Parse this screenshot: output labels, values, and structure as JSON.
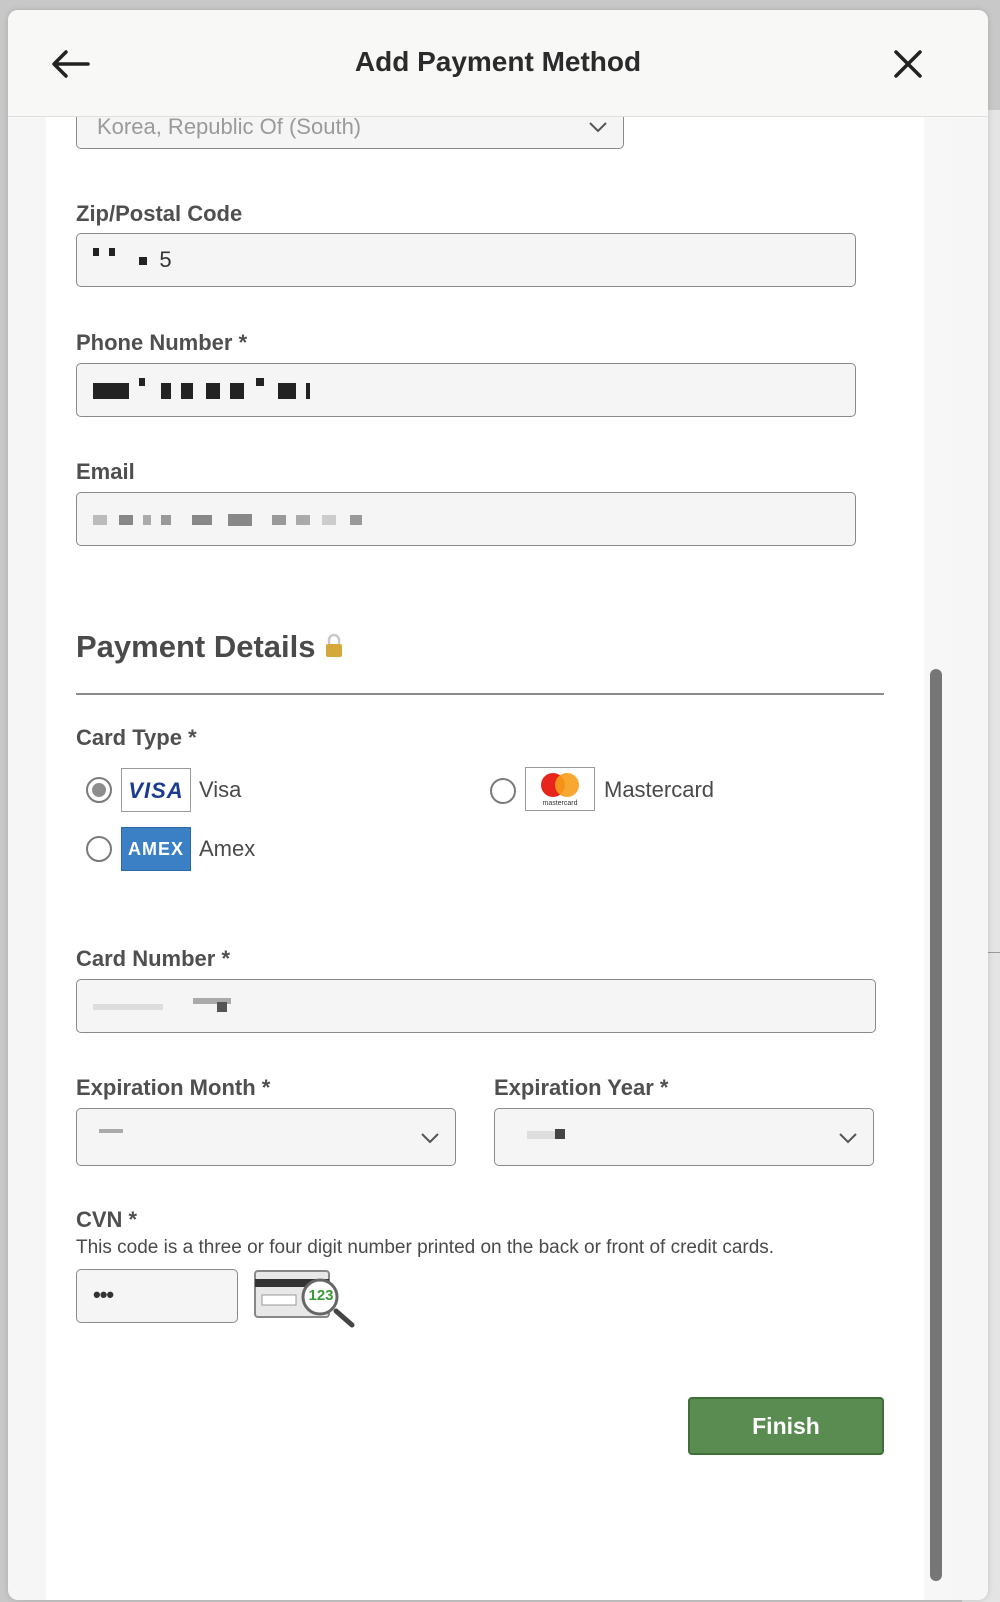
{
  "header": {
    "title": "Add Payment Method"
  },
  "address": {
    "country_value": "Korea, Republic Of (South)",
    "zip_label": "Zip/Postal Code",
    "zip_value_visible": "5",
    "phone_label": "Phone Number *",
    "email_label": "Email"
  },
  "payment": {
    "section_title": "Payment Details",
    "card_type_label": "Card Type *",
    "card_types": [
      {
        "name": "Visa",
        "logo_text": "VISA",
        "selected": true
      },
      {
        "name": "Mastercard",
        "logo_text": "mastercard",
        "selected": false
      },
      {
        "name": "Amex",
        "logo_text": "AMEX",
        "selected": false
      }
    ],
    "card_number_label": "Card Number *",
    "exp_month_label": "Expiration Month *",
    "exp_year_label": "Expiration Year *",
    "cvn_label": "CVN *",
    "cvn_help": "This code is a three or four digit number printed on the back or front of credit cards.",
    "cvn_value": "•••",
    "cvn_image_text": "123",
    "finish_label": "Finish"
  },
  "colors": {
    "finish_button": "#5a8b50",
    "lock_icon": "#d4a93a"
  }
}
